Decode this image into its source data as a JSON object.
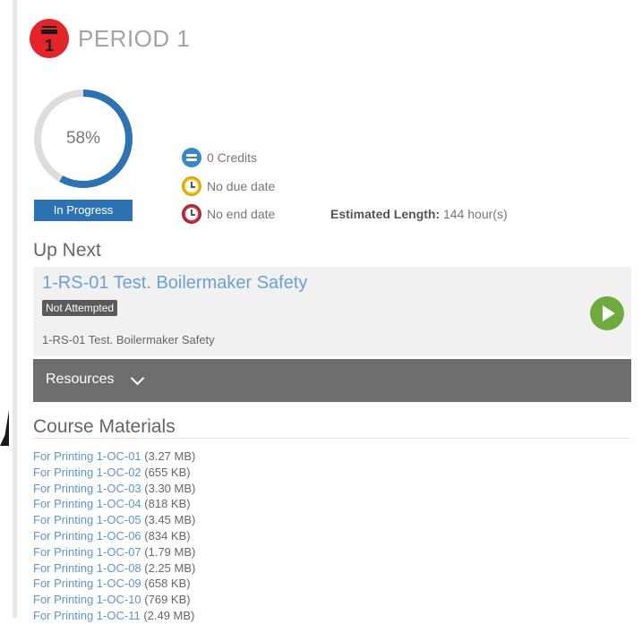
{
  "header": {
    "title": "PERIOD 1",
    "badge_text": "1"
  },
  "progress": {
    "percent": 58,
    "percent_label": "58%",
    "status": "In Progress"
  },
  "meta": {
    "credits": "0 Credits",
    "due_date": "No due date",
    "end_date": "No end date",
    "estimated_label": "Estimated Length:",
    "estimated_value": "144 hour(s)"
  },
  "up_next": {
    "heading": "Up Next",
    "title": "1-RS-01 Test. Boilermaker Safety",
    "status": "Not Attempted",
    "description": "1-RS-01 Test. Boilermaker Safety",
    "play_icon": "play-icon"
  },
  "resources": {
    "label": "Resources",
    "icon": "chevron-down-icon"
  },
  "materials": {
    "heading": "Course Materials",
    "items": [
      {
        "name": "For Printing 1-OC-01",
        "size": "(3.27 MB)"
      },
      {
        "name": "For Printing 1-OC-02",
        "size": "(655 KB)"
      },
      {
        "name": "For Printing 1-OC-03",
        "size": "(3.30 MB)"
      },
      {
        "name": "For Printing 1-OC-04",
        "size": "(818 KB)"
      },
      {
        "name": "For Printing 1-OC-05",
        "size": "(3.45 MB)"
      },
      {
        "name": "For Printing 1-OC-06",
        "size": "(834 KB)"
      },
      {
        "name": "For Printing 1-OC-07",
        "size": "(1.79 MB)"
      },
      {
        "name": "For Printing 1-OC-08",
        "size": "(2.25 MB)"
      },
      {
        "name": "For Printing 1-OC-09",
        "size": "(658 KB)"
      },
      {
        "name": "For Printing 1-OC-10",
        "size": "(769 KB)"
      },
      {
        "name": "For Printing 1-OC-11",
        "size": "(2.49 MB)"
      }
    ]
  },
  "colors": {
    "accent_blue": "#2d73b4",
    "link_blue": "#5f95cf",
    "ring_track": "#dddddd",
    "play_green": "#6eaa3e",
    "badge_red": "#e3242b"
  }
}
